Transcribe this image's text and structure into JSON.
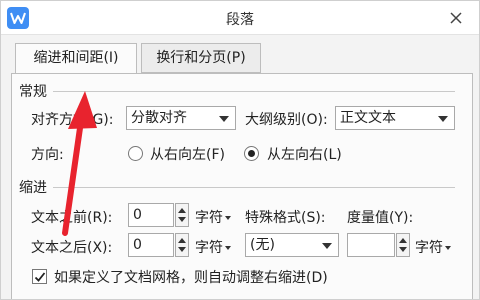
{
  "window": {
    "title": "段落"
  },
  "tabs": [
    {
      "label": "缩进和间距(I)",
      "active": true
    },
    {
      "label": "换行和分页(P)",
      "active": false
    }
  ],
  "general": {
    "section": "常规",
    "alignment_label": "对齐方式(G):",
    "alignment_value": "分散对齐",
    "outline_label": "大纲级别(O):",
    "outline_value": "正文文本",
    "direction_label": "方向:",
    "direction_options": [
      "从右向左(F)",
      "从左向右(L)"
    ],
    "direction_selected": "从左向右(L)"
  },
  "indent": {
    "section": "缩进",
    "before_label": "文本之前(R):",
    "before_value": "0",
    "before_unit": "字符",
    "after_label": "文本之后(X):",
    "after_value": "0",
    "after_unit": "字符",
    "special_label": "特殊格式(S):",
    "special_value": "(无)",
    "measure_label": "度量值(Y):",
    "measure_value": "",
    "measure_unit": "字符",
    "grid_checkbox_label": "如果定义了文档网格，则自动调整右缩进(D)",
    "grid_checkbox_checked": true
  },
  "colors": {
    "annotation_arrow": "#e8232e",
    "app_icon": "#3f8ef4"
  }
}
